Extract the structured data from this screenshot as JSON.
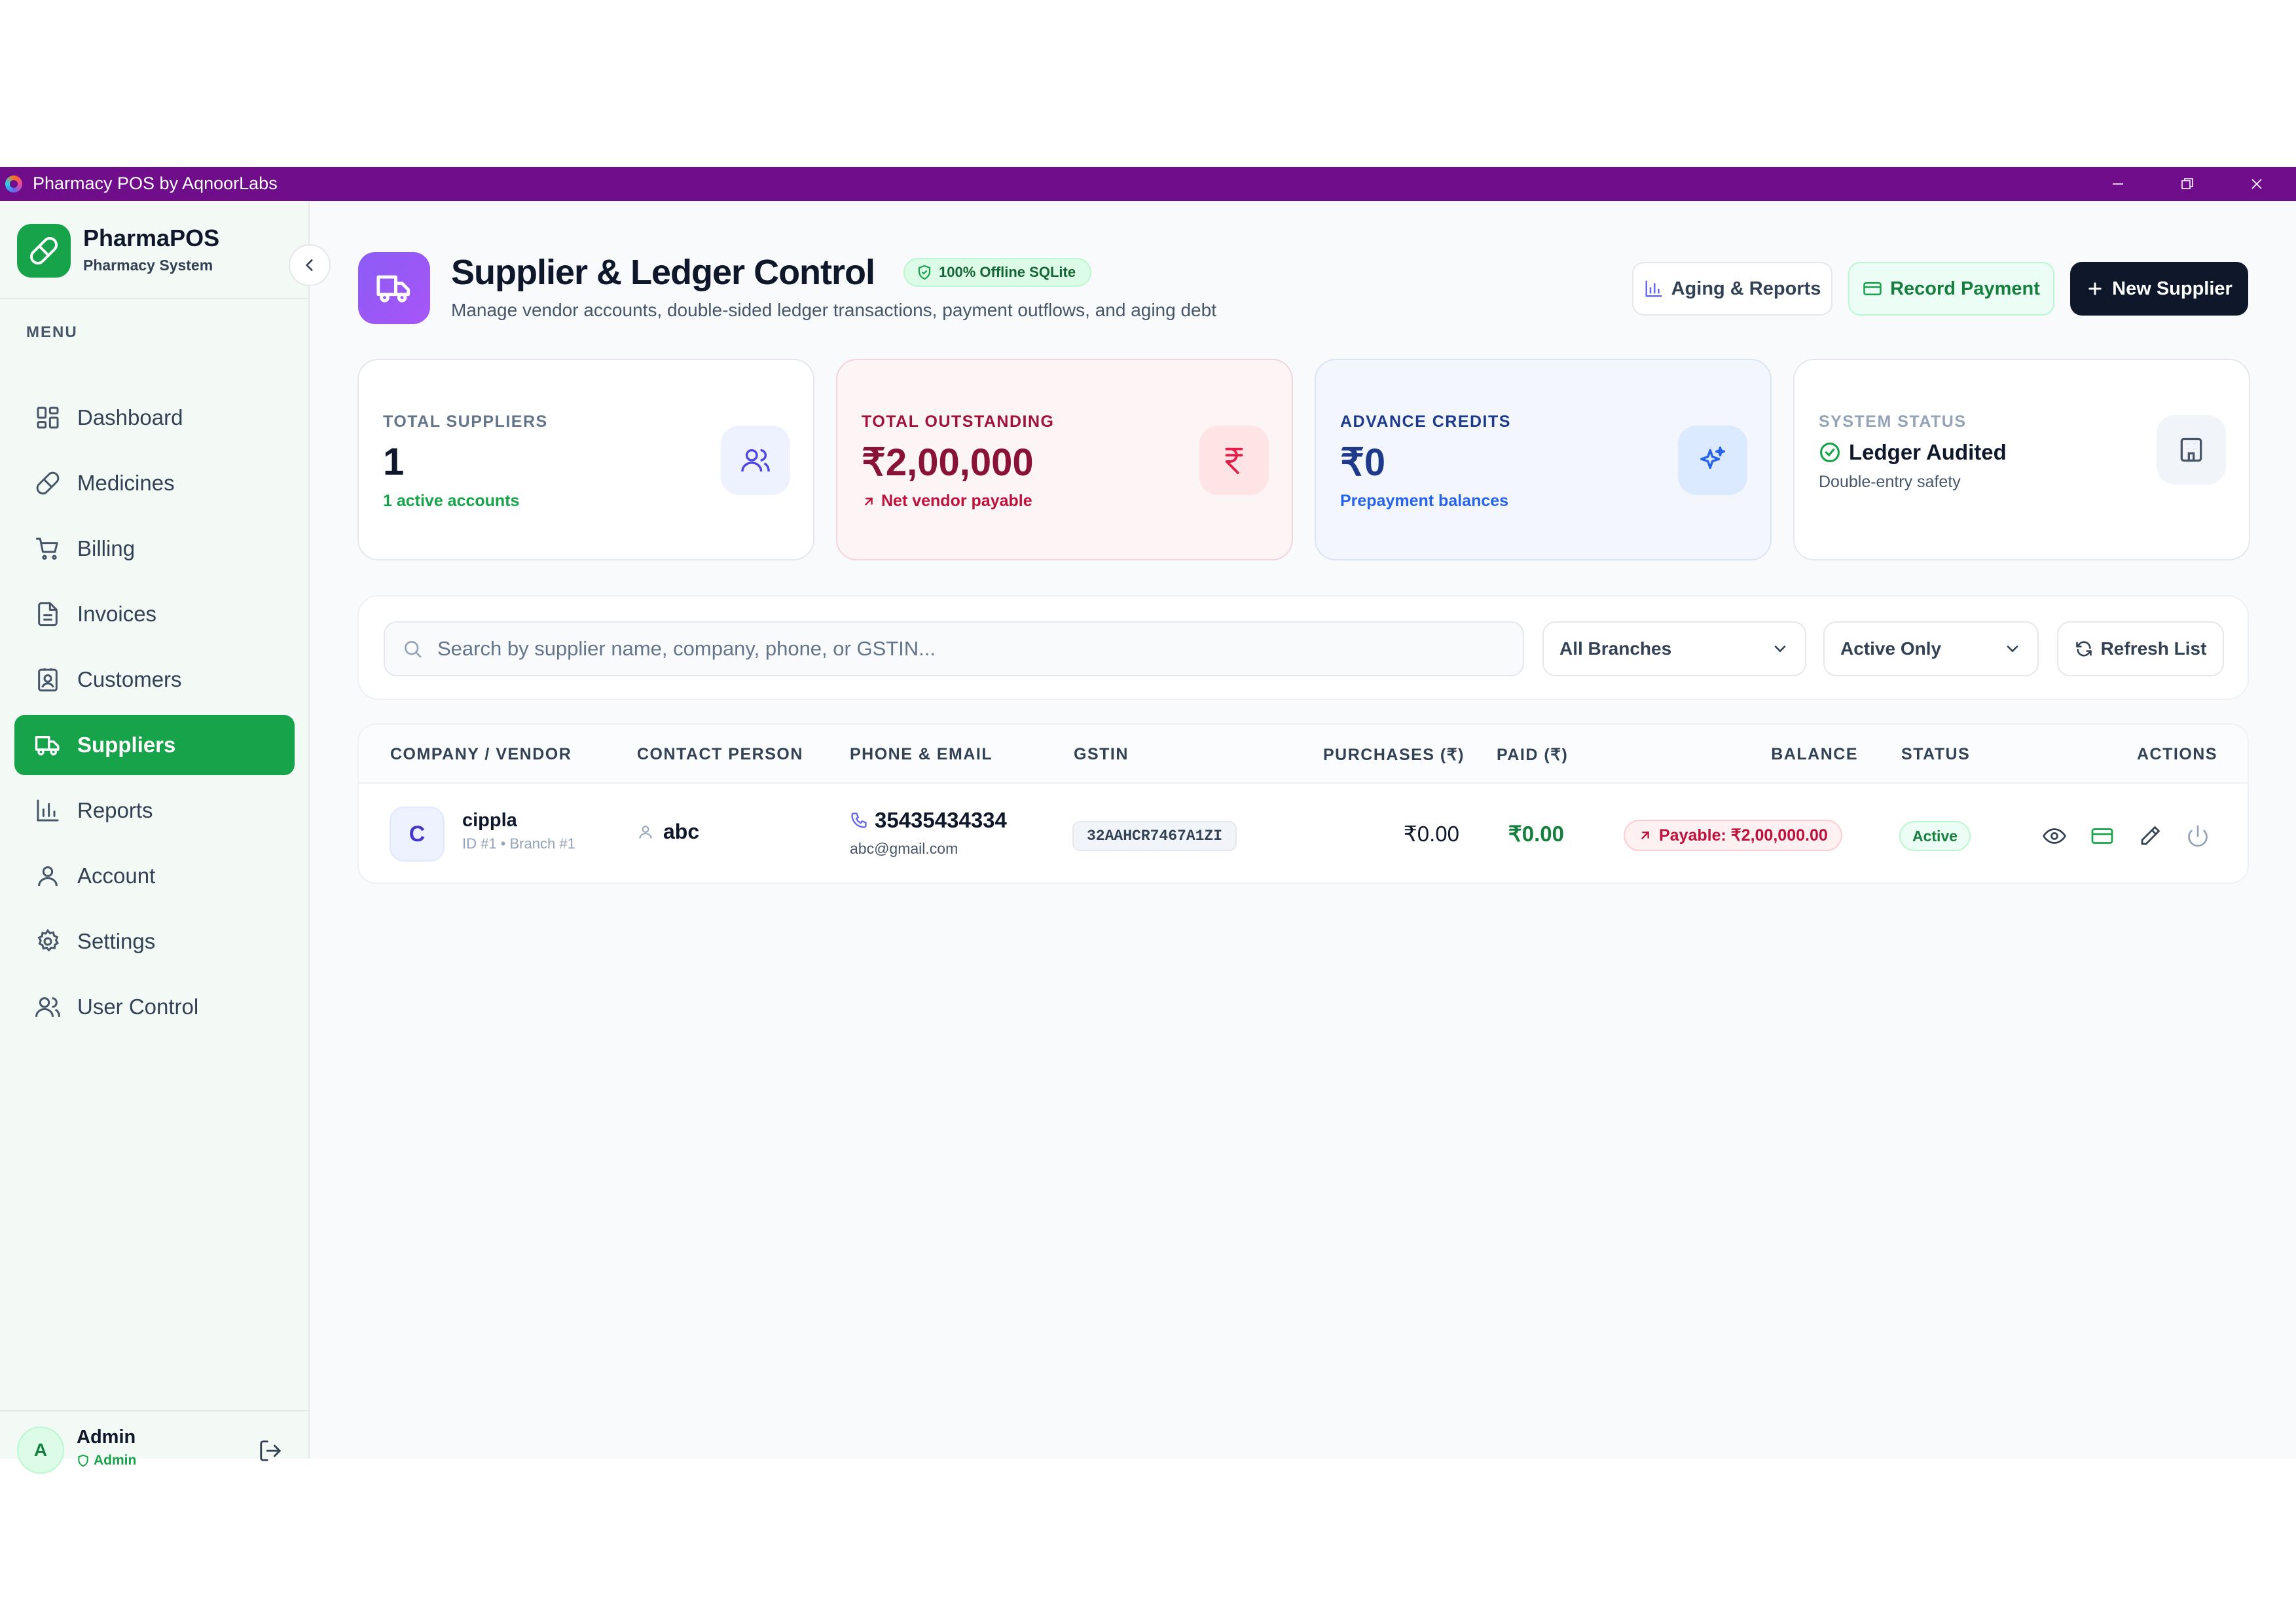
{
  "window": {
    "title": "Pharmacy POS by AqnoorLabs"
  },
  "brand": {
    "name": "PharmaPOS",
    "subtitle": "Pharmacy System"
  },
  "sidebar": {
    "menu_label": "MENU",
    "items": [
      {
        "label": "Dashboard",
        "icon": "dashboard-icon"
      },
      {
        "label": "Medicines",
        "icon": "pill-icon"
      },
      {
        "label": "Billing",
        "icon": "cart-icon"
      },
      {
        "label": "Invoices",
        "icon": "invoice-icon"
      },
      {
        "label": "Customers",
        "icon": "contacts-icon"
      },
      {
        "label": "Suppliers",
        "icon": "truck-icon",
        "active": true
      },
      {
        "label": "Reports",
        "icon": "bar-chart-icon"
      },
      {
        "label": "Account",
        "icon": "user-icon"
      },
      {
        "label": "Settings",
        "icon": "gear-icon"
      },
      {
        "label": "User Control",
        "icon": "users-icon"
      }
    ]
  },
  "user": {
    "initial": "A",
    "name": "Admin",
    "role": "Admin"
  },
  "header": {
    "title": "Supplier & Ledger Control",
    "badge": "100% Offline SQLite",
    "subtitle": "Manage vendor accounts, double-sided ledger transactions, payment outflows, and aging debt",
    "buttons": {
      "aging": "Aging & Reports",
      "record": "Record Payment",
      "new": "New Supplier"
    }
  },
  "stats": {
    "suppliers": {
      "label": "TOTAL SUPPLIERS",
      "value": "1",
      "sub": "1 active accounts"
    },
    "outstanding": {
      "label": "TOTAL OUTSTANDING",
      "value": "₹2,00,000",
      "sub": "Net vendor payable"
    },
    "advance": {
      "label": "ADVANCE CREDITS",
      "value": "₹0",
      "sub": "Prepayment balances"
    },
    "status": {
      "label": "SYSTEM STATUS",
      "value": "Ledger Audited",
      "sub": "Double-entry safety"
    }
  },
  "filters": {
    "search_placeholder": "Search by supplier name, company, phone, or GSTIN...",
    "branch": "All Branches",
    "status": "Active Only",
    "refresh": "Refresh List"
  },
  "table": {
    "headers": {
      "company": "COMPANY / VENDOR",
      "contact": "CONTACT PERSON",
      "phone": "PHONE & EMAIL",
      "gstin": "GSTIN",
      "purchases": "PURCHASES (₹)",
      "paid": "PAID (₹)",
      "balance": "BALANCE",
      "status": "STATUS",
      "actions": "ACTIONS"
    },
    "rows": [
      {
        "initial": "C",
        "name": "cippla",
        "meta": "ID #1 • Branch #1",
        "contact": "abc",
        "phone": "35435434334",
        "email": "abc@gmail.com",
        "gstin": "32AAHCR7467A1ZI",
        "purchases": "₹0.00",
        "paid": "₹0.00",
        "balance": "Payable: ₹2,00,000.00",
        "status": "Active"
      }
    ]
  },
  "colors": {
    "accent": "#16a34a",
    "titlebar": "#6f0d8a",
    "danger": "#be123c",
    "primary_dark": "#0f172a",
    "purple": "#8b5cf6"
  }
}
